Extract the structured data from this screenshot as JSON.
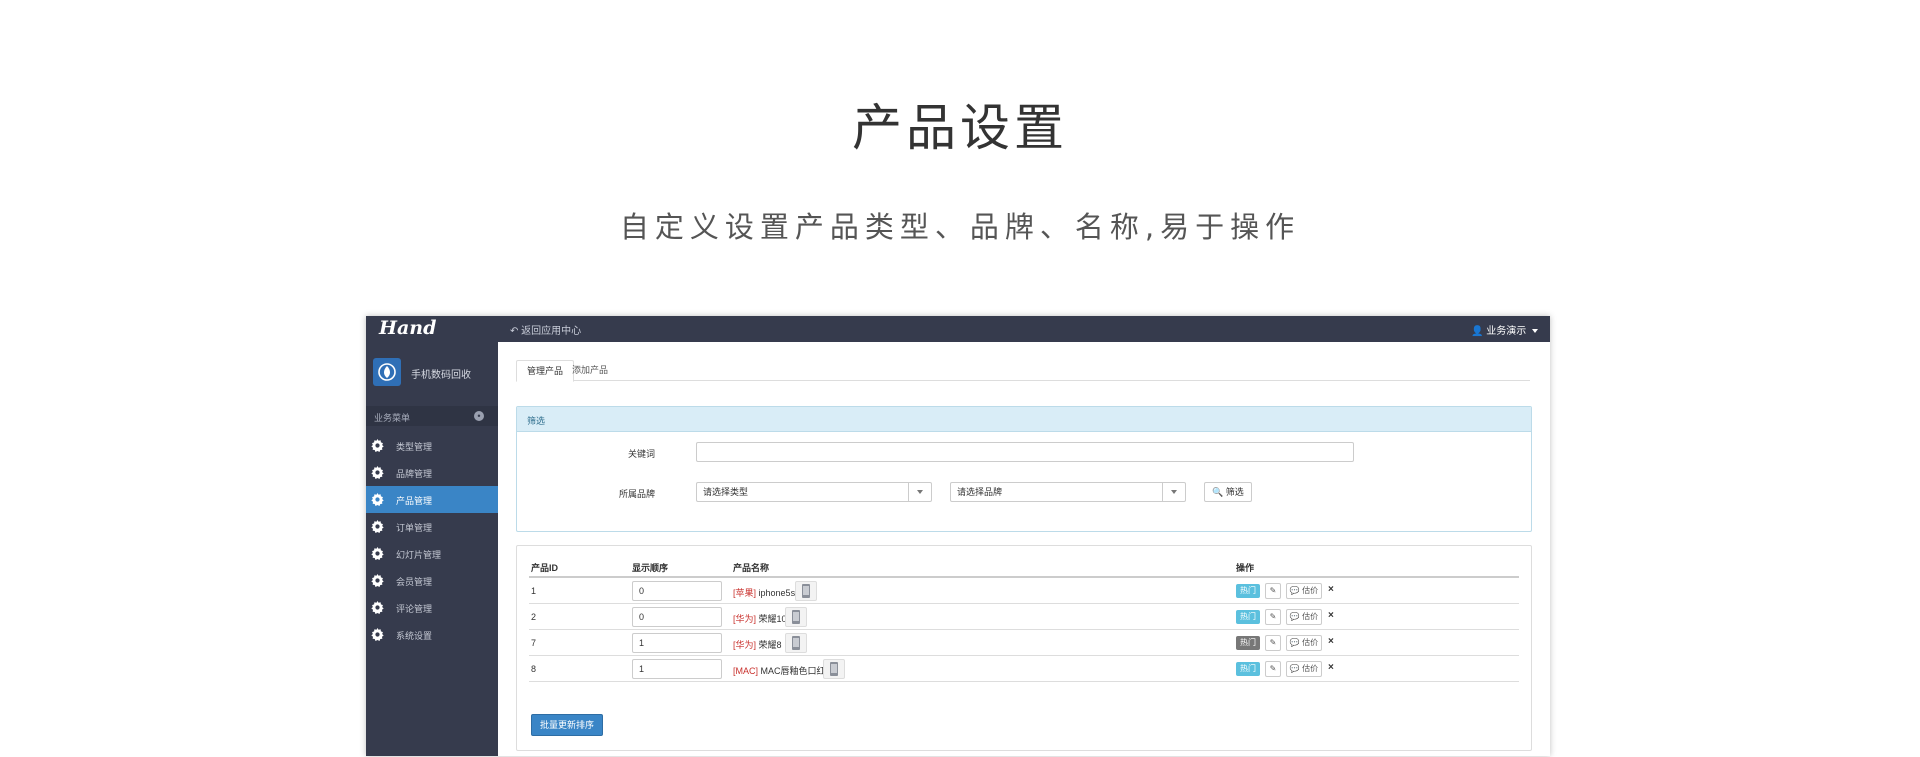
{
  "hero": {
    "title": "产品设置",
    "subtitle": "自定义设置产品类型、品牌、名称,易于操作"
  },
  "topbar": {
    "logo": "Hand",
    "back_link": "返回应用中心",
    "user": "业务演示"
  },
  "sidebar": {
    "app_name": "手机数码回收",
    "menu_title": "业务菜单",
    "items": [
      {
        "label": "类型管理",
        "active": false
      },
      {
        "label": "品牌管理",
        "active": false
      },
      {
        "label": "产品管理",
        "active": true
      },
      {
        "label": "订单管理",
        "active": false
      },
      {
        "label": "幻灯片管理",
        "active": false
      },
      {
        "label": "会员管理",
        "active": false
      },
      {
        "label": "评论管理",
        "active": false
      },
      {
        "label": "系统设置",
        "active": false
      }
    ]
  },
  "tabs": [
    {
      "label": "管理产品",
      "active": true
    },
    {
      "label": "添加产品",
      "active": false
    }
  ],
  "filter": {
    "heading": "筛选",
    "keyword_label": "关键词",
    "keyword_value": "",
    "brand_label": "所属品牌",
    "type_select": "请选择类型",
    "brand_select": "请选择品牌",
    "filter_button": "筛选"
  },
  "table": {
    "headers": [
      "产品ID",
      "显示顺序",
      "产品名称",
      "操作"
    ],
    "rows": [
      {
        "id": "1",
        "order": "0",
        "brand": "[苹果]",
        "name": "iphone5s",
        "hot": true
      },
      {
        "id": "2",
        "order": "0",
        "brand": "[华为]",
        "name": "荣耀10",
        "hot": true
      },
      {
        "id": "7",
        "order": "1",
        "brand": "[华为]",
        "name": "荣耀8",
        "hot": false
      },
      {
        "id": "8",
        "order": "1",
        "brand": "[MAC]",
        "name": "MAC唇釉色口红",
        "hot": true
      }
    ],
    "hot_label": "热门",
    "estimate_label": "估价",
    "batch_button": "批量更新排序"
  },
  "colors": {
    "sidebar_bg": "#363b4d",
    "accent": "#3a85c6",
    "hot_on": "#5bc0de",
    "hot_off": "#777777",
    "brand_text": "#c9302c"
  }
}
